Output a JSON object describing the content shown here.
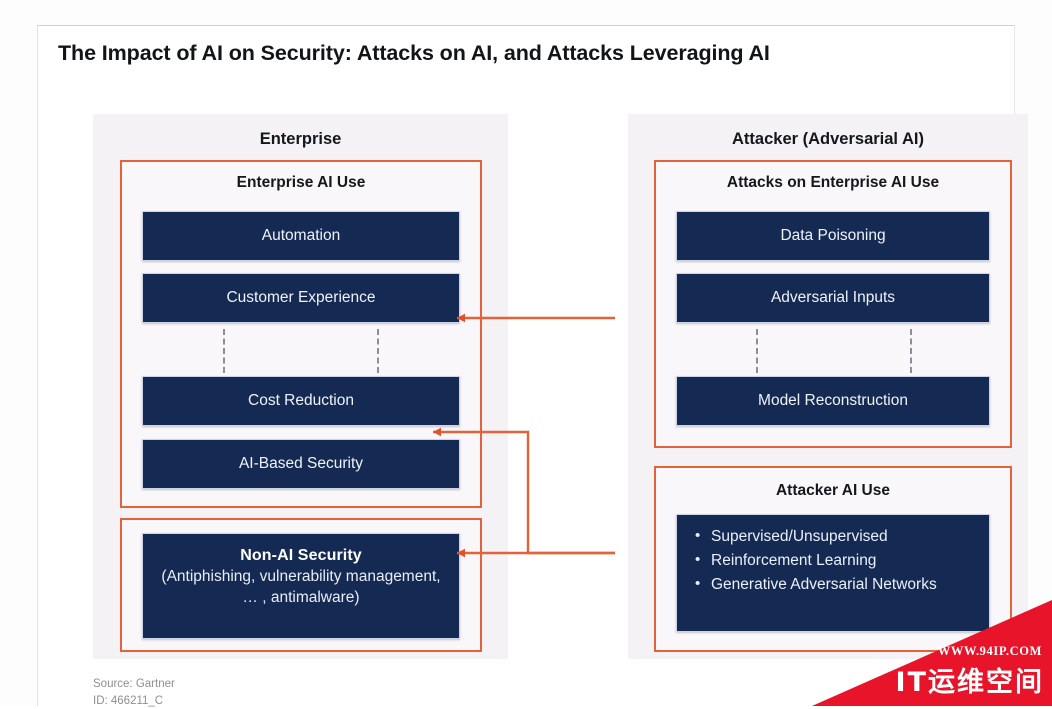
{
  "title": "The Impact of AI on Security: Attacks on AI, and Attacks Leveraging AI",
  "colors": {
    "navy": "#152a52",
    "orange_border": "#e2623a",
    "panel_bg": "#f5f2f6",
    "watermark_red": "#e8142a"
  },
  "left_panel": {
    "heading": "Enterprise",
    "groups": [
      {
        "title": "Enterprise AI Use",
        "boxes": [
          {
            "label": "Automation"
          },
          {
            "label": "Customer Experience"
          },
          {
            "label": "Cost Reduction"
          },
          {
            "label": "AI-Based Security"
          }
        ]
      },
      {
        "title": "",
        "boxes": [
          {
            "title": "Non-AI Security",
            "subtitle": "(Antiphishing, vulnerability management, … , antimalware)"
          }
        ]
      }
    ]
  },
  "right_panel": {
    "heading": "Attacker (Adversarial AI)",
    "groups": [
      {
        "title": "Attacks on Enterprise AI Use",
        "boxes": [
          {
            "label": "Data Poisoning"
          },
          {
            "label": "Adversarial Inputs"
          },
          {
            "label": "Model Reconstruction"
          }
        ]
      },
      {
        "title": "Attacker AI Use",
        "bullets": [
          "Supervised/Unsupervised",
          "Reinforcement Learning",
          "Generative Adversarial Networks"
        ]
      }
    ]
  },
  "connectors": [
    {
      "name": "attacks-to-enterprise-ai-use",
      "from": "Attacks on Enterprise AI Use",
      "to": "Enterprise AI Use"
    },
    {
      "name": "attacker-ai-to-ai-based-security",
      "from": "Attacker AI Use",
      "to": "AI-Based Security"
    },
    {
      "name": "attacker-ai-to-non-ai-security",
      "from": "Attacker AI Use",
      "to": "Non-AI Security"
    }
  ],
  "footer": {
    "source": "Source: Gartner",
    "id": "ID: 466211_C"
  },
  "watermark": {
    "url": "WWW.94IP.COM",
    "name": "IT运维空间"
  }
}
